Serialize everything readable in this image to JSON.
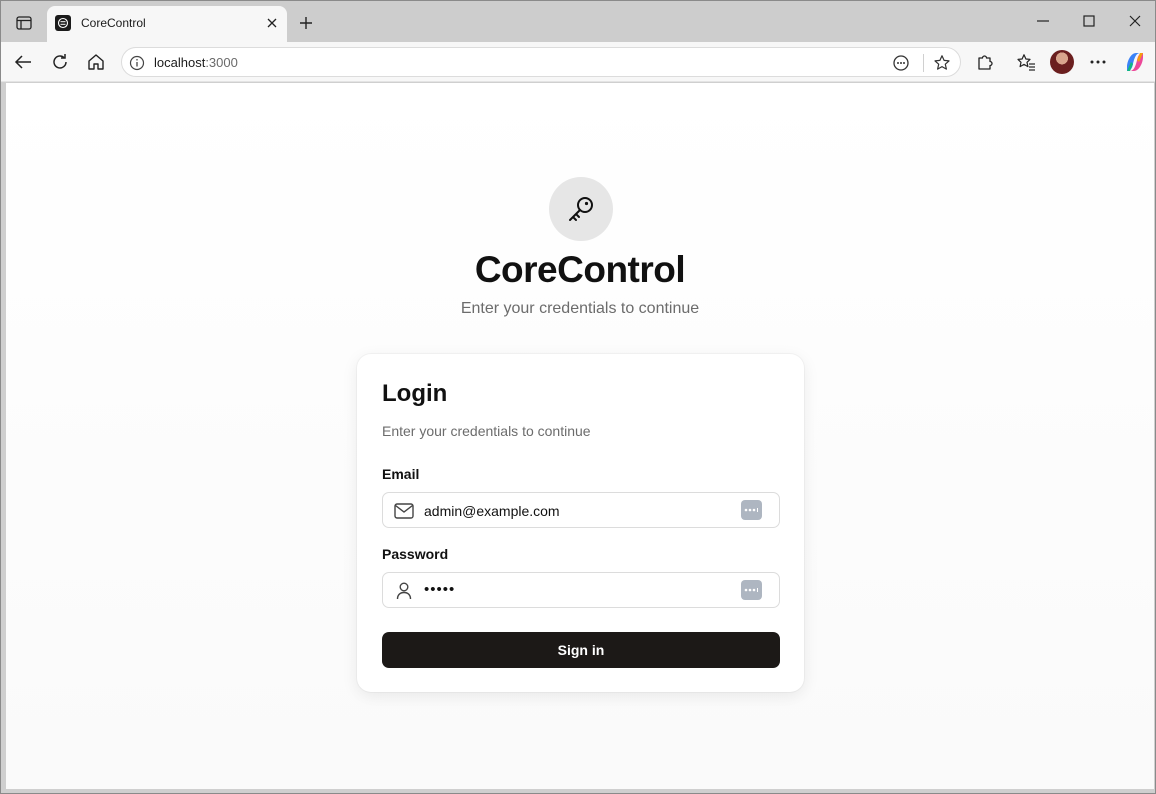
{
  "browser": {
    "tab": {
      "title": "CoreControl"
    },
    "address": {
      "host": "localhost",
      "port": ":3000"
    }
  },
  "page": {
    "brand": "CoreControl",
    "subtitle": "Enter your credentials to continue",
    "card": {
      "title": "Login",
      "description": "Enter your credentials to continue",
      "email": {
        "label": "Email",
        "value": "admin@example.com"
      },
      "password": {
        "label": "Password",
        "value": "•••••"
      },
      "submit_label": "Sign in"
    }
  },
  "icons": {
    "tab_actions": "tab-actions-icon",
    "favicon": "corecontrol-favicon",
    "logo": "key-icon",
    "email": "mail-icon",
    "password": "user-icon",
    "password_manager": "password-manager-icon"
  },
  "colors": {
    "button": "#1c1917",
    "logo_bg": "#e6e6e6"
  }
}
